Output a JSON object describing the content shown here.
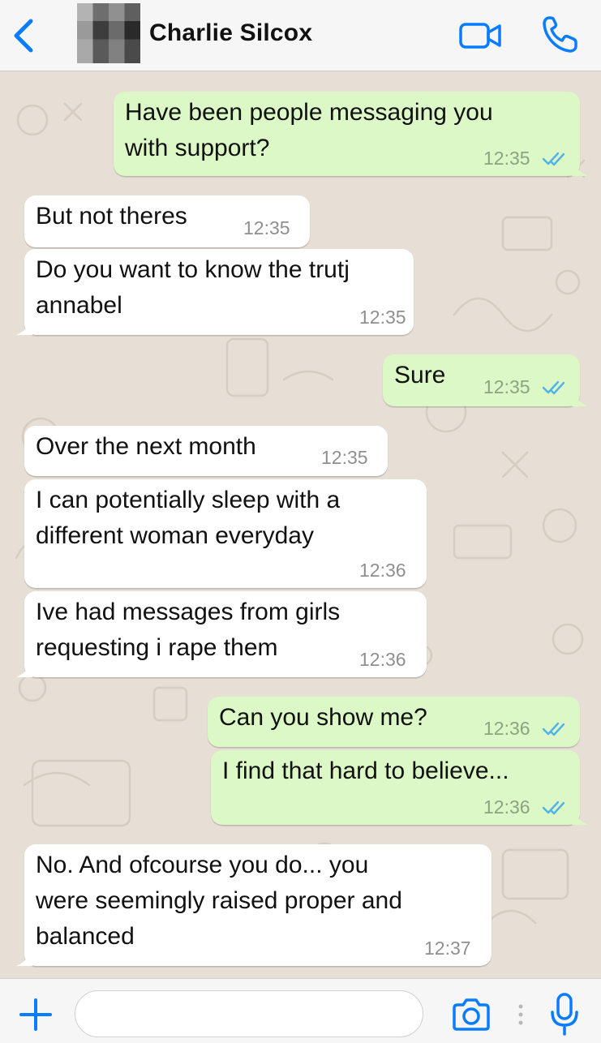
{
  "header": {
    "contact_name": "Charlie Silcox",
    "back_icon": "chevron-left-icon",
    "video_icon": "video-camera-icon",
    "call_icon": "phone-icon"
  },
  "colors": {
    "accent": "#0a7cff",
    "outgoing_bubble": "#dcf8c6",
    "incoming_bubble": "#ffffff",
    "chat_background": "#e7ded5",
    "read_ticks": "#4fb3e8"
  },
  "messages": [
    {
      "direction": "out",
      "lines": [
        "Have been people messaging you",
        "with support?"
      ],
      "time": "12:35",
      "read": true
    },
    {
      "direction": "in",
      "lines": [
        "But not theres"
      ],
      "time": "12:35"
    },
    {
      "direction": "in",
      "lines": [
        "Do you want to know the trutj",
        "annabel"
      ],
      "time": "12:35"
    },
    {
      "direction": "out",
      "lines": [
        "Sure"
      ],
      "time": "12:35",
      "read": true
    },
    {
      "direction": "in",
      "lines": [
        "Over the next month"
      ],
      "time": "12:35"
    },
    {
      "direction": "in",
      "lines": [
        "I can potentially sleep with a",
        "different woman everyday"
      ],
      "time": "12:36"
    },
    {
      "direction": "in",
      "lines": [
        "Ive had messages from girls",
        "requesting i rape them"
      ],
      "time": "12:36"
    },
    {
      "direction": "out",
      "lines": [
        "Can you show me?"
      ],
      "time": "12:36",
      "read": true
    },
    {
      "direction": "out",
      "lines": [
        "I find that hard to believe..."
      ],
      "time": "12:36",
      "read": true
    },
    {
      "direction": "in",
      "lines": [
        "No. And ofcourse you do... you",
        "were seemingly raised proper and",
        "balanced"
      ],
      "time": "12:37"
    }
  ],
  "composer": {
    "placeholder": "",
    "plus_icon": "plus-icon",
    "camera_icon": "camera-icon",
    "mic_icon": "microphone-icon"
  }
}
